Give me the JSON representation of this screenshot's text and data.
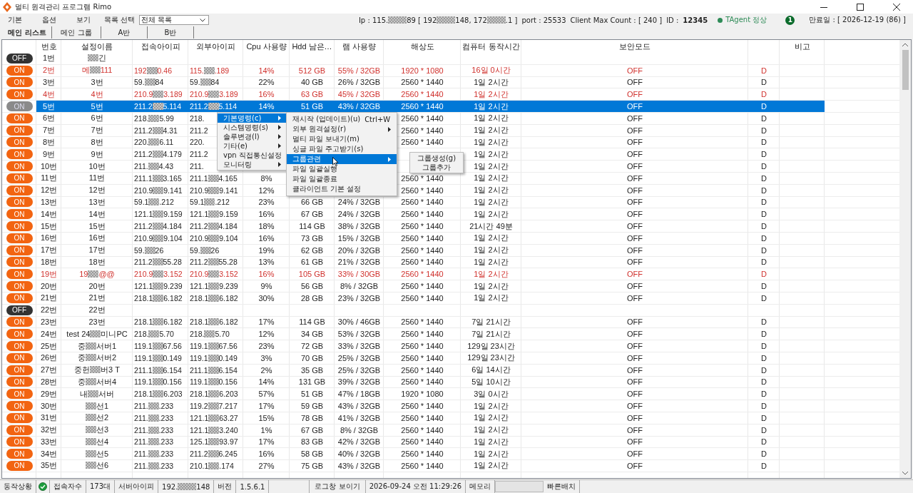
{
  "window": {
    "title": "멀티 원격관리 프로그램 Rimo"
  },
  "menu": [
    "기본",
    "옵션",
    "보기"
  ],
  "list_select": {
    "label": "목록 선택",
    "value": "전체 목록"
  },
  "info": {
    "ip": [
      "Ip : 115.",
      "89 [ 192",
      "148, 172",
      ".1 ]"
    ],
    "port": "port : 25533",
    "max_count": "Client Max Count :  [ 240 ]",
    "id_label": "ID :",
    "id": "12345",
    "agent": {
      "label": "TAgent 정상",
      "ok": true
    },
    "badge": "1",
    "expiry": "만료일 : [ 2026-12-19 (86) ]"
  },
  "tabs": [
    {
      "label": "메인 리스트",
      "selected": true
    },
    {
      "label": "메인 그룹",
      "selected": false
    },
    {
      "label": "A반",
      "selected": false
    },
    {
      "label": "B반",
      "selected": false
    }
  ],
  "columns": {
    "no": "번호",
    "name": "설정이름",
    "ip": "접속아이피",
    "ext": "외부아이피",
    "cpu": "Cpu 사용량",
    "hdd": "Hdd 남은…",
    "ram": "램 사용량",
    "res": "해상도",
    "up": "컴퓨터 동작시간",
    "sec": "보안모드",
    "note": "비고"
  },
  "rows": [
    {
      "power": "OFF",
      "on": false,
      "selected": false,
      "alert": false,
      "cells": {
        "no": "1번",
        "name": {
          "post": "긴"
        }
      }
    },
    {
      "power": "ON",
      "on": true,
      "selected": false,
      "alert": true,
      "cells": {
        "no": "2번",
        "name": {
          "pre": "메",
          "post": "111"
        },
        "ip": {
          "pre": "192",
          "post": "0.46"
        },
        "ext": {
          "pre": "115.",
          "post": ".189"
        },
        "cpu": "14%",
        "hdd": "512 GB",
        "ram": "55% / 32GB",
        "res": "1920 * 1080",
        "up": "16일 0시간",
        "sec": "OFF",
        "flag": "D"
      }
    },
    {
      "power": "ON",
      "on": true,
      "selected": false,
      "alert": false,
      "cells": {
        "no": "3번",
        "name": "3번",
        "ip": {
          "pre": "59.",
          "post": "84"
        },
        "ext": {
          "pre": "59.",
          "post": "84"
        },
        "cpu": "22%",
        "hdd": "40 GB",
        "ram": "26% / 32GB",
        "res": "2560 * 1440",
        "up": "1일 2시간",
        "sec": "OFF",
        "flag": "D"
      }
    },
    {
      "power": "ON",
      "on": true,
      "selected": false,
      "alert": true,
      "cells": {
        "no": "4번",
        "name": "4번",
        "ip": {
          "pre": "210.9",
          "post": "3.189"
        },
        "ext": {
          "pre": "210.9",
          "post": "3.189"
        },
        "cpu": "16%",
        "hdd": "63 GB",
        "ram": "45% / 32GB",
        "res": "2560 * 1440",
        "up": "1일 2시간",
        "sec": "OFF",
        "flag": "D"
      }
    },
    {
      "power": "ON",
      "on": true,
      "selected": true,
      "alert": false,
      "cells": {
        "no": "5번",
        "name": "5번",
        "ip": {
          "pre": "211.2",
          "post": "5.114"
        },
        "ext": {
          "pre": "211.2",
          "post": "5.114"
        },
        "cpu": "14%",
        "hdd": "51 GB",
        "ram": "43% / 32GB",
        "res": "2560 * 1440",
        "up": "1일 2시간",
        "sec": "OFF",
        "flag": "D"
      }
    },
    {
      "power": "ON",
      "on": true,
      "selected": false,
      "alert": false,
      "cells": {
        "no": "6번",
        "name": "6번",
        "ip": {
          "pre": "218.",
          "post": "5.99"
        },
        "ext": "218.",
        "res": "2560 * 1440",
        "up": "1일 2시간",
        "sec": "OFF",
        "flag": "D"
      }
    },
    {
      "power": "ON",
      "on": true,
      "selected": false,
      "alert": false,
      "cells": {
        "no": "7번",
        "name": "7번",
        "ip": {
          "pre": "211.2",
          "post": "4.31"
        },
        "ext": "211.2",
        "res": "2560 * 1440",
        "up": "1일 2시간",
        "sec": "OFF",
        "flag": "D"
      }
    },
    {
      "power": "ON",
      "on": true,
      "selected": false,
      "alert": false,
      "cells": {
        "no": "8번",
        "name": "8번",
        "ip": {
          "pre": "220.",
          "post": "6.11"
        },
        "ext": "220.",
        "res": "2560 * 1440",
        "up": "1일 2시간",
        "sec": "OFF",
        "flag": "D"
      }
    },
    {
      "power": "ON",
      "on": true,
      "selected": false,
      "alert": false,
      "cells": {
        "no": "9번",
        "name": "9번",
        "ip": {
          "pre": "211.2",
          "post": "4.179"
        },
        "ext": "211.2",
        "up": "1일 2시간",
        "sec": "OFF",
        "flag": "D"
      }
    },
    {
      "power": "ON",
      "on": true,
      "selected": false,
      "alert": false,
      "cells": {
        "no": "10번",
        "name": "10번",
        "ip": {
          "pre": "211.",
          "post": "4.43"
        },
        "ext": "211.",
        "up": "1일 2시간",
        "sec": "OFF",
        "flag": "D"
      }
    },
    {
      "power": "ON",
      "on": true,
      "selected": false,
      "alert": false,
      "cells": {
        "no": "11번",
        "name": "11번",
        "ip": {
          "pre": "211.1",
          "post": "3.165"
        },
        "ext": {
          "pre": "211.1",
          "post": "4.165"
        },
        "cpu": "8%",
        "res": "2560 * 1440",
        "up": "1일 2시간",
        "sec": "OFF",
        "flag": "D"
      }
    },
    {
      "power": "ON",
      "on": true,
      "selected": false,
      "alert": false,
      "cells": {
        "no": "12번",
        "name": "12번",
        "ip": {
          "pre": "210.9",
          "post": "9.141"
        },
        "ext": {
          "pre": "210.9",
          "post": "9.141"
        },
        "cpu": "12%",
        "res": "2560 * 1440",
        "up": "1일 2시간",
        "sec": "OFF",
        "flag": "D"
      }
    },
    {
      "power": "ON",
      "on": true,
      "selected": false,
      "alert": false,
      "cells": {
        "no": "13번",
        "name": "13번",
        "ip": {
          "pre": "59.1",
          "post": ".212"
        },
        "ext": {
          "pre": "59.1",
          "post": ".212"
        },
        "cpu": "23%",
        "hdd": "66 GB",
        "ram": "24% / 32GB",
        "res": "2560 * 1440",
        "up": "1일 2시간",
        "sec": "OFF",
        "flag": "D"
      }
    },
    {
      "power": "ON",
      "on": true,
      "selected": false,
      "alert": false,
      "cells": {
        "no": "14번",
        "name": "14번",
        "ip": {
          "pre": "121.1",
          "post": "9.159"
        },
        "ext": {
          "pre": "121.1",
          "post": "9.159"
        },
        "cpu": "16%",
        "hdd": "67 GB",
        "ram": "24% / 32GB",
        "res": "2560 * 1440",
        "up": "1일 2시간",
        "sec": "OFF",
        "flag": "D"
      }
    },
    {
      "power": "ON",
      "on": true,
      "selected": false,
      "alert": false,
      "cells": {
        "no": "15번",
        "name": "15번",
        "ip": {
          "pre": "211.2",
          "post": "4.184"
        },
        "ext": {
          "pre": "211.2",
          "post": "4.184"
        },
        "cpu": "18%",
        "hdd": "114 GB",
        "ram": "38% / 32GB",
        "res": "2560 * 1440",
        "up": "21시간 49분",
        "sec": "OFF",
        "flag": "D"
      }
    },
    {
      "power": "ON",
      "on": true,
      "selected": false,
      "alert": false,
      "cells": {
        "no": "16번",
        "name": "16번",
        "ip": {
          "pre": "210.9",
          "post": "9.104"
        },
        "ext": {
          "pre": "210.9",
          "post": "9.104"
        },
        "cpu": "16%",
        "hdd": "73 GB",
        "ram": "15% / 32GB",
        "res": "2560 * 1440",
        "up": "1일 2시간",
        "sec": "OFF",
        "flag": "D"
      }
    },
    {
      "power": "ON",
      "on": true,
      "selected": false,
      "alert": false,
      "cells": {
        "no": "17번",
        "name": "17번",
        "ip": {
          "pre": "59.",
          "post": "26"
        },
        "ext": {
          "pre": "59.",
          "post": "26"
        },
        "cpu": "19%",
        "hdd": "62 GB",
        "ram": "20% / 32GB",
        "res": "2560 * 1440",
        "up": "1일 2시간",
        "sec": "OFF",
        "flag": "D"
      }
    },
    {
      "power": "ON",
      "on": true,
      "selected": false,
      "alert": false,
      "cells": {
        "no": "18번",
        "name": "18번",
        "ip": {
          "pre": "211.2",
          "post": "55.28"
        },
        "ext": {
          "pre": "211.2",
          "post": "55.28"
        },
        "cpu": "13%",
        "hdd": "61 GB",
        "ram": "21% / 32GB",
        "res": "2560 * 1440",
        "up": "1일 2시간",
        "sec": "OFF",
        "flag": "D"
      }
    },
    {
      "power": "ON",
      "on": true,
      "selected": false,
      "alert": true,
      "cells": {
        "no": "19번",
        "name": {
          "pre": "19",
          "post": "@@"
        },
        "ip": {
          "pre": "210.9",
          "post": "3.152"
        },
        "ext": {
          "pre": "210.9",
          "post": "3.152"
        },
        "cpu": "16%",
        "hdd": "105 GB",
        "ram": "33% / 30GB",
        "res": "2560 * 1440",
        "up": "1일 2시간",
        "sec": "OFF",
        "flag": "D"
      }
    },
    {
      "power": "ON",
      "on": true,
      "selected": false,
      "alert": false,
      "cells": {
        "no": "20번",
        "name": "20번",
        "ip": {
          "pre": "121.1",
          "post": "9.239"
        },
        "ext": {
          "pre": "121.1",
          "post": "9.239"
        },
        "cpu": "9%",
        "hdd": "56 GB",
        "ram": "8% / 32GB",
        "res": "2560 * 1440",
        "up": "1일 2시간",
        "sec": "OFF",
        "flag": "D"
      }
    },
    {
      "power": "ON",
      "on": true,
      "selected": false,
      "alert": false,
      "cells": {
        "no": "21번",
        "name": "21번",
        "ip": {
          "pre": "218.1",
          "post": "6.182"
        },
        "ext": {
          "pre": "218.1",
          "post": "6.182"
        },
        "cpu": "30%",
        "hdd": "28 GB",
        "ram": "23% / 32GB",
        "res": "2560 * 1440",
        "up": "1일 2시간",
        "sec": "OFF",
        "flag": "D"
      }
    },
    {
      "power": "OFF",
      "on": false,
      "selected": false,
      "alert": false,
      "cells": {
        "no": "22번",
        "name": "22번"
      }
    },
    {
      "power": "ON",
      "on": true,
      "selected": false,
      "alert": false,
      "cells": {
        "no": "23번",
        "name": "23번",
        "ip": {
          "pre": "218.1",
          "post": "6.182"
        },
        "ext": {
          "pre": "218.1",
          "post": "6.182"
        },
        "cpu": "17%",
        "hdd": "114 GB",
        "ram": "30% / 46GB",
        "res": "2560 * 1440",
        "up": "7일 21시간",
        "sec": "OFF",
        "flag": "D"
      }
    },
    {
      "power": "ON",
      "on": true,
      "selected": false,
      "alert": false,
      "cells": {
        "no": "24번",
        "name": {
          "pre": "test 24",
          "post": "미니PC"
        },
        "ip": {
          "pre": "218.",
          "post": "5.70"
        },
        "ext": {
          "pre": "218.",
          "post": "5.70"
        },
        "cpu": "12%",
        "hdd": "34 GB",
        "ram": "53% / 32GB",
        "res": "2560 * 1440",
        "up": "7일 21시간",
        "sec": "OFF",
        "flag": "D"
      }
    },
    {
      "power": "ON",
      "on": true,
      "selected": false,
      "alert": false,
      "cells": {
        "no": "25번",
        "name": {
          "pre": "중",
          "post": "서버1"
        },
        "ip": {
          "pre": "119.1",
          "post": "67.56"
        },
        "ext": {
          "pre": "119.1",
          "post": "67.56"
        },
        "cpu": "23%",
        "hdd": "72 GB",
        "ram": "33% / 32GB",
        "res": "2560 * 1440",
        "up": "129일 23시간",
        "sec": "OFF",
        "flag": "D"
      }
    },
    {
      "power": "ON",
      "on": true,
      "selected": false,
      "alert": false,
      "cells": {
        "no": "26번",
        "name": {
          "pre": "중",
          "post": "서버2"
        },
        "ip": {
          "pre": "119.1",
          "post": "0.149"
        },
        "ext": {
          "pre": "119.1",
          "post": "0.149"
        },
        "cpu": "3%",
        "hdd": "70 GB",
        "ram": "25% / 32GB",
        "res": "2560 * 1440",
        "up": "129일 23시간",
        "sec": "OFF",
        "flag": "D"
      }
    },
    {
      "power": "ON",
      "on": true,
      "selected": false,
      "alert": false,
      "cells": {
        "no": "27번",
        "name": {
          "pre": "중헌",
          "post": "버3 T"
        },
        "ip": {
          "pre": "211.1",
          "post": "6.154"
        },
        "ext": {
          "pre": "211.1",
          "post": "6.154"
        },
        "cpu": "2%",
        "hdd": "35 GB",
        "ram": "25% / 32GB",
        "res": "2560 * 1440",
        "up": "6일 14시간",
        "sec": "OFF",
        "flag": "D"
      }
    },
    {
      "power": "ON",
      "on": true,
      "selected": false,
      "alert": false,
      "cells": {
        "no": "28번",
        "name": {
          "pre": "중",
          "post": "서버4"
        },
        "ip": {
          "pre": "119.1",
          "post": "0.156"
        },
        "ext": {
          "pre": "119.1",
          "post": "0.156"
        },
        "cpu": "14%",
        "hdd": "131 GB",
        "ram": "39% / 32GB",
        "res": "2560 * 1440",
        "up": "5일 10시간",
        "sec": "OFF",
        "flag": "D"
      }
    },
    {
      "power": "ON",
      "on": true,
      "selected": false,
      "alert": false,
      "cells": {
        "no": "29번",
        "name": {
          "pre": "내",
          "post": "서버"
        },
        "ip": {
          "pre": "218.1",
          "post": "6.203"
        },
        "ext": {
          "pre": "218.1",
          "post": "6.203"
        },
        "cpu": "57%",
        "hdd": "51 GB",
        "ram": "47% / 18GB",
        "res": "1920 * 1080",
        "up": "3일 0시간",
        "sec": "OFF",
        "flag": "D"
      }
    },
    {
      "power": "ON",
      "on": true,
      "selected": false,
      "alert": false,
      "cells": {
        "no": "30번",
        "name": {
          "post": "선1"
        },
        "ip": {
          "pre": "211.",
          "post": ".233"
        },
        "ext": {
          "pre": "119.2",
          "post": "7.217"
        },
        "cpu": "17%",
        "hdd": "59 GB",
        "ram": "43% / 32GB",
        "res": "2560 * 1440",
        "up": "1일 2시간",
        "sec": "OFF",
        "flag": "D"
      }
    },
    {
      "power": "ON",
      "on": true,
      "selected": false,
      "alert": false,
      "cells": {
        "no": "31번",
        "name": {
          "post": "선2"
        },
        "ip": {
          "pre": "211.",
          "post": ".233"
        },
        "ext": {
          "pre": "121.1",
          "post": "63.27"
        },
        "cpu": "15%",
        "hdd": "78 GB",
        "ram": "41% / 32GB",
        "res": "2560 * 1440",
        "up": "1일 2시간",
        "sec": "OFF",
        "flag": "D"
      }
    },
    {
      "power": "ON",
      "on": true,
      "selected": false,
      "alert": false,
      "cells": {
        "no": "32번",
        "name": {
          "post": "선3"
        },
        "ip": {
          "pre": "211.",
          "post": ".233"
        },
        "ext": {
          "pre": "121.1",
          "post": "3.240"
        },
        "cpu": "1%",
        "hdd": "67 GB",
        "ram": "8% / 32GB",
        "res": "2560 * 1440",
        "up": "1일 2시간",
        "sec": "OFF",
        "flag": "D"
      }
    },
    {
      "power": "ON",
      "on": true,
      "selected": false,
      "alert": false,
      "cells": {
        "no": "33번",
        "name": {
          "post": "선4"
        },
        "ip": {
          "pre": "211.",
          "post": ".233"
        },
        "ext": {
          "pre": "125.1",
          "post": "93.97"
        },
        "cpu": "17%",
        "hdd": "83 GB",
        "ram": "42% / 32GB",
        "res": "2560 * 1440",
        "up": "1일 2시간",
        "sec": "OFF",
        "flag": "D"
      }
    },
    {
      "power": "ON",
      "on": true,
      "selected": false,
      "alert": false,
      "cells": {
        "no": "34번",
        "name": {
          "post": "선5"
        },
        "ip": {
          "pre": "211.",
          "post": ".233"
        },
        "ext": {
          "pre": "211.2",
          "post": "6.245"
        },
        "cpu": "16%",
        "hdd": "58 GB",
        "ram": "40% / 32GB",
        "res": "2560 * 1440",
        "up": "1일 2시간",
        "sec": "OFF",
        "flag": "D"
      }
    },
    {
      "power": "ON",
      "on": true,
      "selected": false,
      "alert": false,
      "cells": {
        "no": "35번",
        "name": {
          "post": "선6"
        },
        "ip": {
          "pre": "211.",
          "post": ".233"
        },
        "ext": {
          "pre": "210.1",
          "post": ".174"
        },
        "cpu": "27%",
        "hdd": "75 GB",
        "ram": "43% / 32GB",
        "res": "2560 * 1440",
        "up": "1일 2시간",
        "sec": "OFF",
        "flag": "D"
      }
    }
  ],
  "context_menu": [
    {
      "label": "기본명령(c)",
      "selected": true
    },
    {
      "label": "시스템명령(s)",
      "selected": false
    },
    {
      "label": "솔루변경(l)",
      "selected": false
    },
    {
      "label": "기타(e)",
      "selected": false
    },
    {
      "label": "vpn 직접통신설정",
      "selected": false
    },
    {
      "label": "모니터링",
      "selected": false
    }
  ],
  "submenu": [
    {
      "label": "재시작 (업데이트)(u)",
      "shortcut": "Ctrl+W",
      "submenu": false,
      "selected": false
    },
    {
      "label": "외부 원격설정(r)",
      "submenu": true,
      "selected": false
    },
    {
      "label": "멀티 파일 보내기(m)",
      "submenu": false,
      "selected": false
    },
    {
      "label": "싱글 파일 주고받기(s)",
      "submenu": false,
      "selected": false
    },
    {
      "label": "그룹관련",
      "submenu": true,
      "selected": true
    },
    {
      "label": "파일 일괄실행",
      "submenu": false,
      "selected": false
    },
    {
      "label": "파일 일괄종료",
      "submenu": false,
      "selected": false
    },
    {
      "label": "클라이언트 기본 설정",
      "submenu": false,
      "selected": false
    }
  ],
  "group_menu": [
    "그룹생성(g)",
    "그룹추가"
  ],
  "status_bar": [
    {
      "kind": "label",
      "text": "동작상황"
    },
    {
      "kind": "icon"
    },
    {
      "kind": "label",
      "text": "접속자수"
    },
    {
      "kind": "value",
      "text": "173대"
    },
    {
      "kind": "label",
      "text": "서버아이피"
    },
    {
      "kind": "value",
      "parts": [
        "192.",
        "148"
      ]
    },
    {
      "kind": "label",
      "text": "버전"
    },
    {
      "kind": "value",
      "text": "1.5.6.1"
    },
    {
      "kind": "button",
      "text": "로그창 보이기"
    },
    {
      "kind": "value",
      "text": "2026-09-24 오전 11:29:26"
    },
    {
      "kind": "label",
      "text": "메모리"
    },
    {
      "kind": "blank"
    },
    {
      "kind": "label",
      "text": "빠른배치"
    }
  ]
}
